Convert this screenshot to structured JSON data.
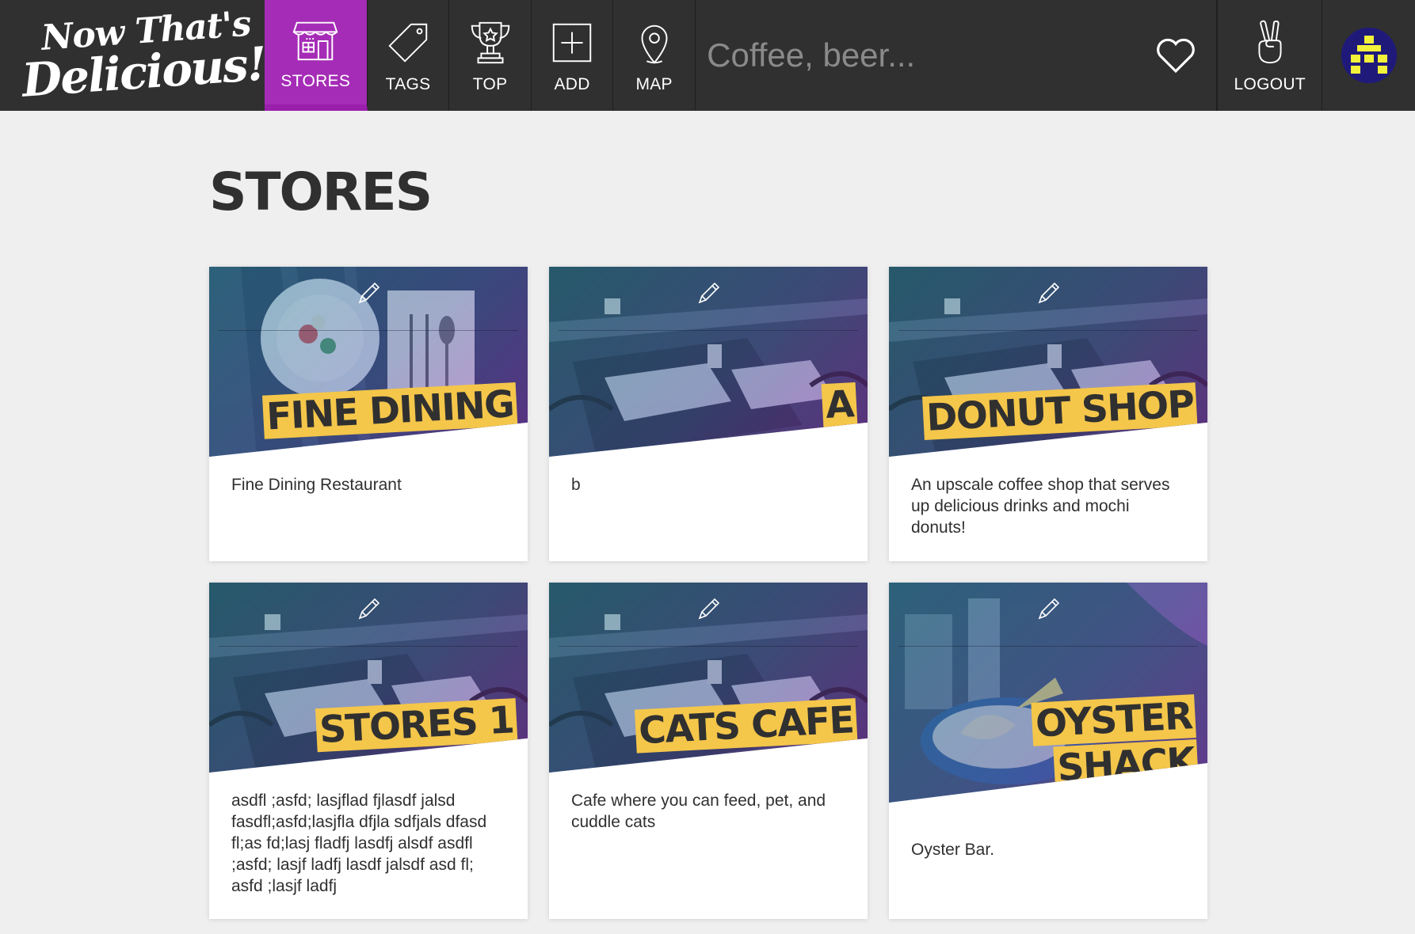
{
  "nav": {
    "logo_line1": "Now That's",
    "logo_line2": "Delicious!",
    "items": [
      {
        "label": "STORES",
        "icon": "store-icon",
        "active": true
      },
      {
        "label": "TAGS",
        "icon": "tag-icon"
      },
      {
        "label": "TOP",
        "icon": "trophy-icon"
      },
      {
        "label": "ADD",
        "icon": "add-icon"
      },
      {
        "label": "MAP",
        "icon": "map-pin-icon"
      }
    ],
    "search_placeholder": "Coffee, beer...",
    "heart_icon": "heart-icon",
    "logout_label": "LOGOUT",
    "logout_icon": "peace-hand-icon",
    "avatar_icon": "avatar-icon"
  },
  "page": {
    "title": "STORES"
  },
  "stores": [
    {
      "name": "FINE DINING",
      "description": "Fine Dining Restaurant",
      "image": "plate-scene"
    },
    {
      "name": "A",
      "description": "b",
      "image": "restaurant-scene"
    },
    {
      "name": "DONUT SHOP",
      "description": "An upscale coffee shop that serves up delicious drinks and mochi donuts!",
      "image": "restaurant-scene"
    },
    {
      "name": "STORES 1",
      "description": "asdfl ;asfd; lasjflad fjlasdf jalsd fasdfl;asfd;lasjfla dfjla sdfjals dfasd fl;as fd;lasj fladfj lasdfj alsdf asdfl ;asfd; lasjf ladfj lasdf jalsdf asd fl; asfd ;lasjf ladfj",
      "image": "restaurant-scene"
    },
    {
      "name": "CATS CAFE",
      "description": "Cafe where you can feed, pet, and cuddle cats",
      "image": "restaurant-scene"
    },
    {
      "name": "OYSTER SHACK",
      "description": "Oyster Bar.",
      "image": "oyster-scene"
    }
  ],
  "colors": {
    "nav_bg": "#303030",
    "active": "#a52cb6",
    "title_highlight": "#f4c64a",
    "page_bg": "#efefef"
  }
}
